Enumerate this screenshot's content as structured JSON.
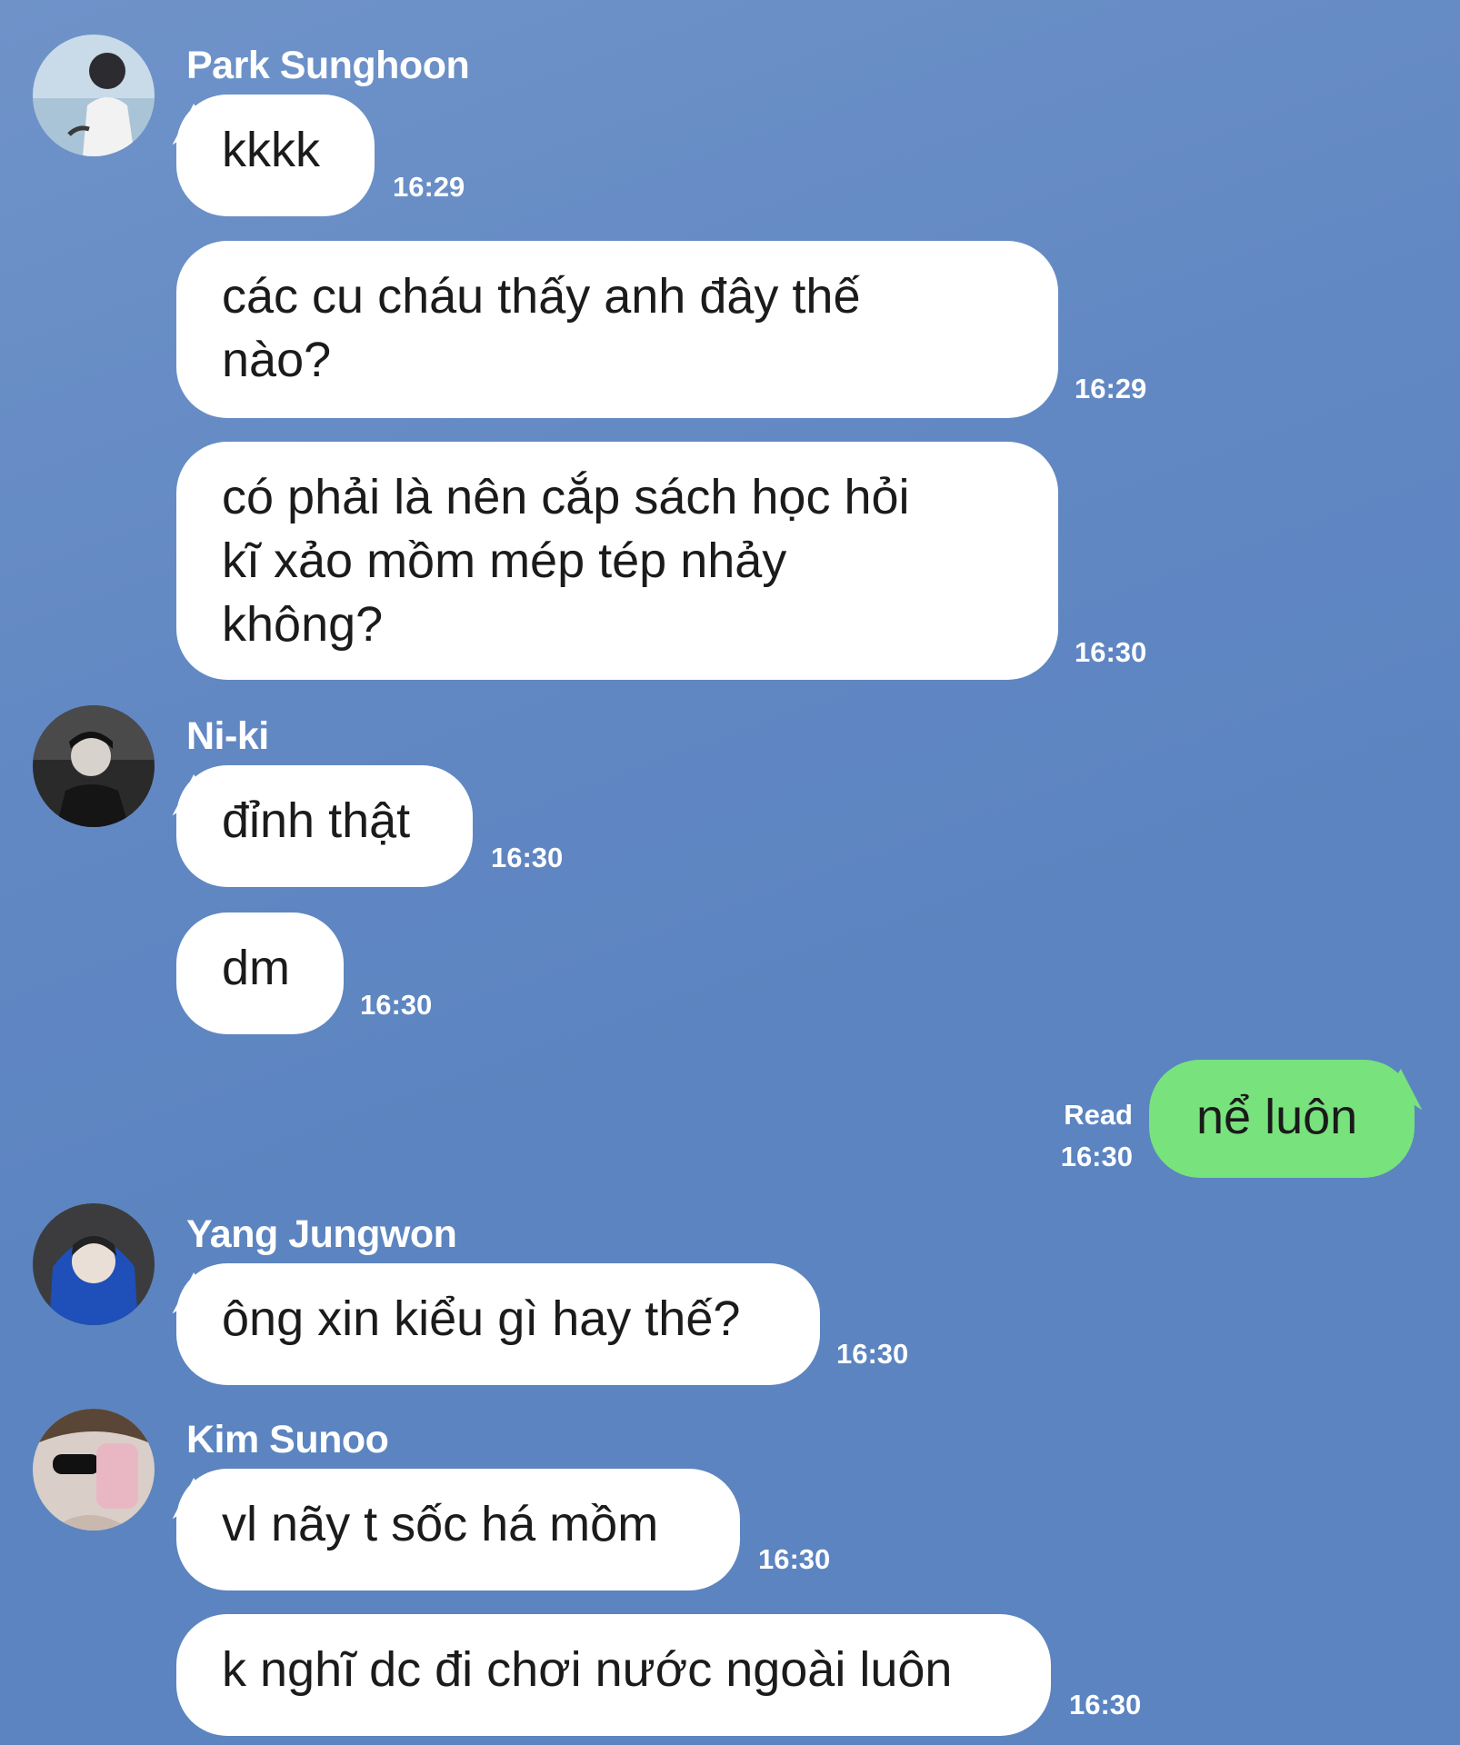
{
  "messages": [
    {
      "sender": "Park Sunghoon",
      "avatar_icon": "profile-photo-sunghoon",
      "bubbles": [
        {
          "lines": [
            "kkkk"
          ],
          "time": "16:29"
        },
        {
          "lines": [
            "các cu cháu thấy anh đây thế",
            "nào?"
          ],
          "time": "16:29"
        },
        {
          "lines": [
            "có phải là nên cắp sách học hỏi",
            "kĩ xảo mồm mép tép nhảy",
            "không?"
          ],
          "time": "16:30"
        }
      ]
    },
    {
      "sender": "Ni-ki",
      "avatar_icon": "profile-photo-niki",
      "bubbles": [
        {
          "lines": [
            "đỉnh thật"
          ],
          "time": "16:30"
        },
        {
          "lines": [
            "dm"
          ],
          "time": "16:30"
        }
      ]
    },
    {
      "sender": "",
      "mine": true,
      "bubbles": [
        {
          "lines": [
            "nể luôn"
          ],
          "time": "16:30",
          "status": "Read"
        }
      ]
    },
    {
      "sender": "Yang Jungwon",
      "avatar_icon": "profile-photo-jungwon",
      "bubbles": [
        {
          "lines": [
            "ông xin kiểu gì hay thế?"
          ],
          "time": "16:30"
        }
      ]
    },
    {
      "sender": "Kim Sunoo",
      "avatar_icon": "profile-photo-sunoo",
      "bubbles": [
        {
          "lines": [
            "vl nãy t sốc há mồm"
          ],
          "time": "16:30"
        },
        {
          "lines": [
            "k nghĩ dc đi chơi nước ngoài luôn"
          ],
          "time": "16:30"
        }
      ]
    }
  ],
  "colors": {
    "background": "#5d86c2",
    "incoming_bubble": "#ffffff",
    "outgoing_bubble": "#78e27c",
    "meta_text": "#ffffff"
  }
}
